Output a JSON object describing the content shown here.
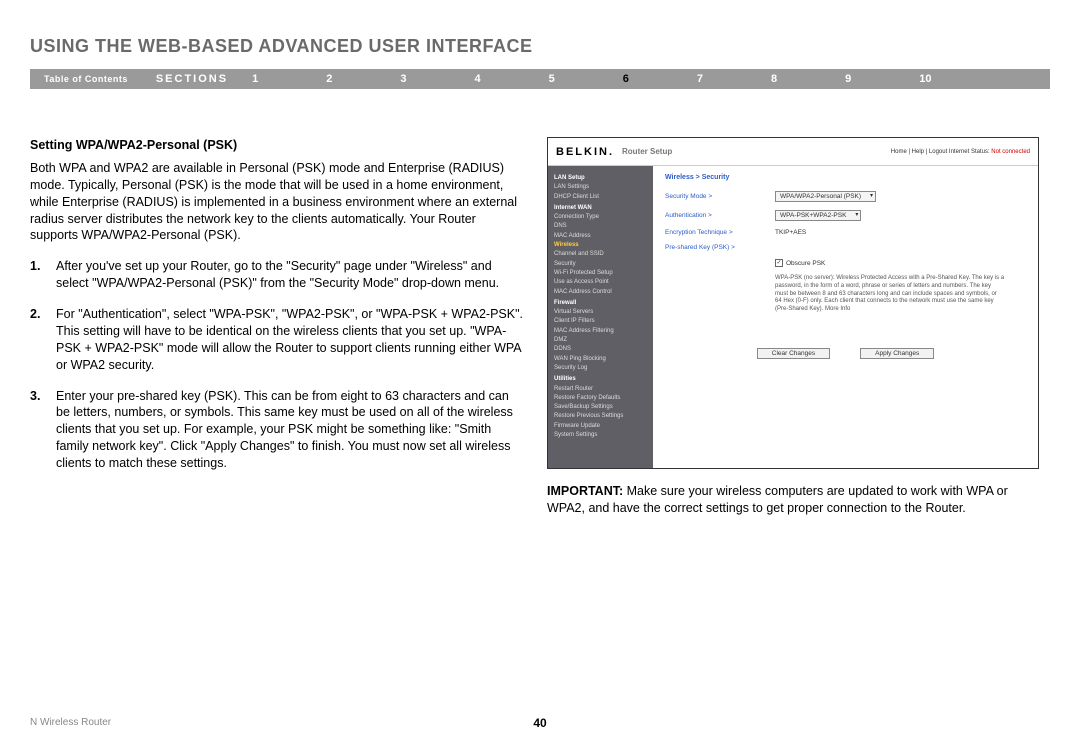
{
  "header": {
    "title": "USING THE WEB-BASED ADVANCED USER INTERFACE",
    "toc": "Table of Contents",
    "sections_label": "SECTIONS",
    "section_numbers": [
      "1",
      "2",
      "3",
      "4",
      "5",
      "6",
      "7",
      "8",
      "9",
      "10"
    ],
    "current_section": "6"
  },
  "left": {
    "subtitle": "Setting WPA/WPA2-Personal (PSK)",
    "intro": "Both WPA and WPA2 are available in Personal (PSK) mode and Enterprise (RADIUS) mode. Typically, Personal (PSK) is the mode that will be used in a home environment, while Enterprise (RADIUS) is implemented in a business environment where an external radius server distributes the network key to the clients automatically. Your Router supports WPA/WPA2-Personal (PSK).",
    "steps": [
      {
        "num": "1.",
        "text": "After you've set up your Router, go to the \"Security\" page under \"Wireless\" and select \"WPA/WPA2-Personal (PSK)\" from the \"Security Mode\" drop-down menu."
      },
      {
        "num": "2.",
        "text": "For \"Authentication\", select \"WPA-PSK\", \"WPA2-PSK\", or \"WPA-PSK + WPA2-PSK\". This setting will have to be identical on the wireless clients that you set up. \"WPA-PSK + WPA2-PSK\" mode will allow the Router to support clients running either WPA or WPA2 security."
      },
      {
        "num": "3.",
        "text": "Enter your pre-shared key (PSK). This can be from eight to 63 characters and can be letters, numbers, or symbols. This same key must be used on all of the wireless clients that you set up. For example, your PSK might be something like: \"Smith family network key\". Click \"Apply Changes\" to finish. You must now set all wireless clients to match these settings."
      }
    ]
  },
  "router": {
    "logo": "BELKIN",
    "setup_title": "Router Setup",
    "top_links": "Home | Help | Logout   Internet Status: ",
    "status": "Not connected",
    "sidebar": [
      {
        "t": "LAN Setup",
        "c": "cat"
      },
      {
        "t": "LAN Settings"
      },
      {
        "t": "DHCP Client List"
      },
      {
        "t": "Internet WAN",
        "c": "cat"
      },
      {
        "t": "Connection Type"
      },
      {
        "t": "DNS"
      },
      {
        "t": "MAC Address"
      },
      {
        "t": "Wireless",
        "c": "hl"
      },
      {
        "t": "Channel and SSID"
      },
      {
        "t": "Security"
      },
      {
        "t": "Wi-Fi Protected Setup"
      },
      {
        "t": "Use as Access Point"
      },
      {
        "t": "MAC Address Control"
      },
      {
        "t": "Firewall",
        "c": "cat"
      },
      {
        "t": "Virtual Servers"
      },
      {
        "t": "Client IP Filters"
      },
      {
        "t": "MAC Address Filtering"
      },
      {
        "t": "DMZ"
      },
      {
        "t": "DDNS"
      },
      {
        "t": "WAN Ping Blocking"
      },
      {
        "t": "Security Log"
      },
      {
        "t": "Utilities",
        "c": "cat"
      },
      {
        "t": "Restart Router"
      },
      {
        "t": "Restore Factory Defaults"
      },
      {
        "t": "Save/Backup Settings"
      },
      {
        "t": "Restore Previous Settings"
      },
      {
        "t": "Firmware Update"
      },
      {
        "t": "System Settings"
      }
    ],
    "breadcrumb": "Wireless > Security",
    "form": {
      "security_mode_label": "Security Mode >",
      "security_mode_value": "WPA/WPA2-Personal (PSK)",
      "auth_label": "Authentication >",
      "auth_value": "WPA-PSK+WPA2-PSK",
      "enc_label": "Encryption Technique >",
      "enc_value": "TKIP+AES",
      "psk_label": "Pre-shared Key (PSK) >",
      "obscure_label": "Obscure PSK",
      "finetext": "WPA-PSK (no server): Wireless Protected Access with a Pre-Shared Key. The key is a password, in the form of a word, phrase or series of letters and numbers. The key must be between 8 and 63 characters long and can include spaces and symbols, or 64 Hex (0-F) only. Each client that connects to the network must use the same key (Pre-Shared Key). More Info",
      "clear_btn": "Clear Changes",
      "apply_btn": "Apply Changes"
    }
  },
  "important": {
    "label": "IMPORTANT:",
    "text": " Make sure your wireless computers are updated to work with WPA or WPA2, and have the correct settings to get proper connection to the Router."
  },
  "footer": {
    "product": "N Wireless Router",
    "page": "40"
  }
}
